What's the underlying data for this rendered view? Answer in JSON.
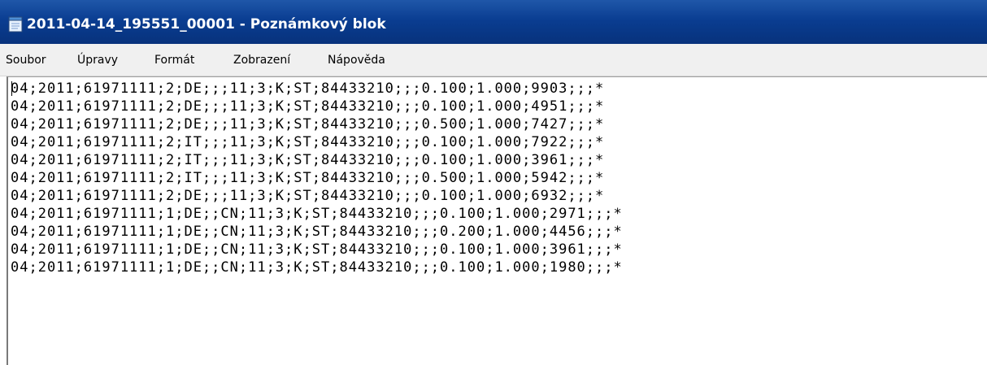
{
  "window": {
    "title": "2011-04-14_195551_00001 - Poznámkový blok",
    "icon": "notepad-icon",
    "colors": {
      "titlebar": "#0a3d91",
      "menubar": "#f0f0f0",
      "editor_bg": "#ffffff"
    }
  },
  "menu": {
    "items": [
      "Soubor",
      "Úpravy",
      "Formát",
      "Zobrazení",
      "Nápověda"
    ]
  },
  "editor": {
    "lines": [
      "04;2011;61971111;2;DE;;;11;3;K;ST;84433210;;;0.100;1.000;9903;;;*",
      "04;2011;61971111;2;DE;;;11;3;K;ST;84433210;;;0.100;1.000;4951;;;*",
      "04;2011;61971111;2;DE;;;11;3;K;ST;84433210;;;0.500;1.000;7427;;;*",
      "04;2011;61971111;2;IT;;;11;3;K;ST;84433210;;;0.100;1.000;7922;;;*",
      "04;2011;61971111;2;IT;;;11;3;K;ST;84433210;;;0.100;1.000;3961;;;*",
      "04;2011;61971111;2;IT;;;11;3;K;ST;84433210;;;0.500;1.000;5942;;;*",
      "04;2011;61971111;2;DE;;;11;3;K;ST;84433210;;;0.100;1.000;6932;;;*",
      "04;2011;61971111;1;DE;;CN;11;3;K;ST;84433210;;;0.100;1.000;2971;;;*",
      "04;2011;61971111;1;DE;;CN;11;3;K;ST;84433210;;;0.200;1.000;4456;;;*",
      "04;2011;61971111;1;DE;;CN;11;3;K;ST;84433210;;;0.100;1.000;3961;;;*",
      "04;2011;61971111;1;DE;;CN;11;3;K;ST;84433210;;;0.100;1.000;1980;;;*"
    ]
  }
}
